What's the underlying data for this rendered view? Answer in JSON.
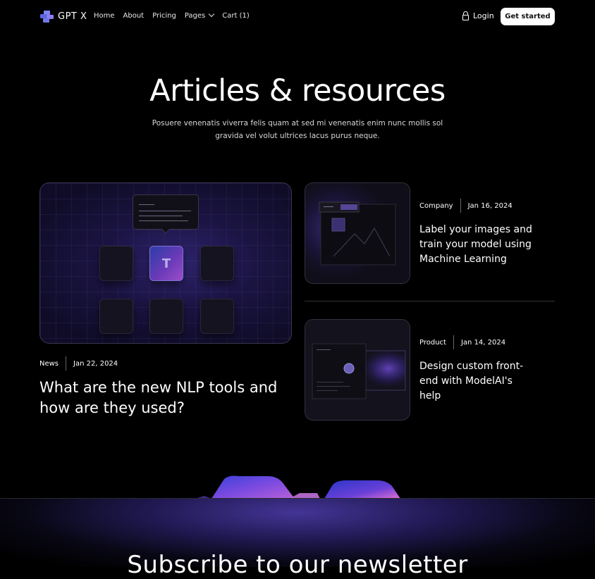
{
  "brand": {
    "name": "GPT X"
  },
  "nav": {
    "links": [
      "Home",
      "About",
      "Pricing",
      "Pages",
      "Cart (1)"
    ],
    "login": "Login",
    "cta": "Get started"
  },
  "hero": {
    "title": "Articles & resources",
    "subtitle": "Posuere venenatis viverra felis quam at sed mi venenatis enim nunc mollis sol gravida vel volut ultrices lacus purus neque."
  },
  "articles": [
    {
      "category": "News",
      "date": "Jan 22, 2024",
      "title": "What are the new NLP tools and how are they used?"
    },
    {
      "category": "Company",
      "date": "Jan 16, 2024",
      "title": "Label your images and train your model using Machine Learning"
    },
    {
      "category": "Product",
      "date": "Jan 14, 2024",
      "title": "Design custom front-end with ModelAI's help"
    }
  ],
  "featured_tile_letter": "T",
  "newsletter": {
    "title": "Subscribe to our newsletter"
  },
  "colors": {
    "accent": "#6a3ab8",
    "background": "#000000",
    "button_bg": "#ffffff"
  },
  "icons": {
    "logo": "logo-icon",
    "login": "lock-icon",
    "pages": "chevron-down-icon"
  }
}
